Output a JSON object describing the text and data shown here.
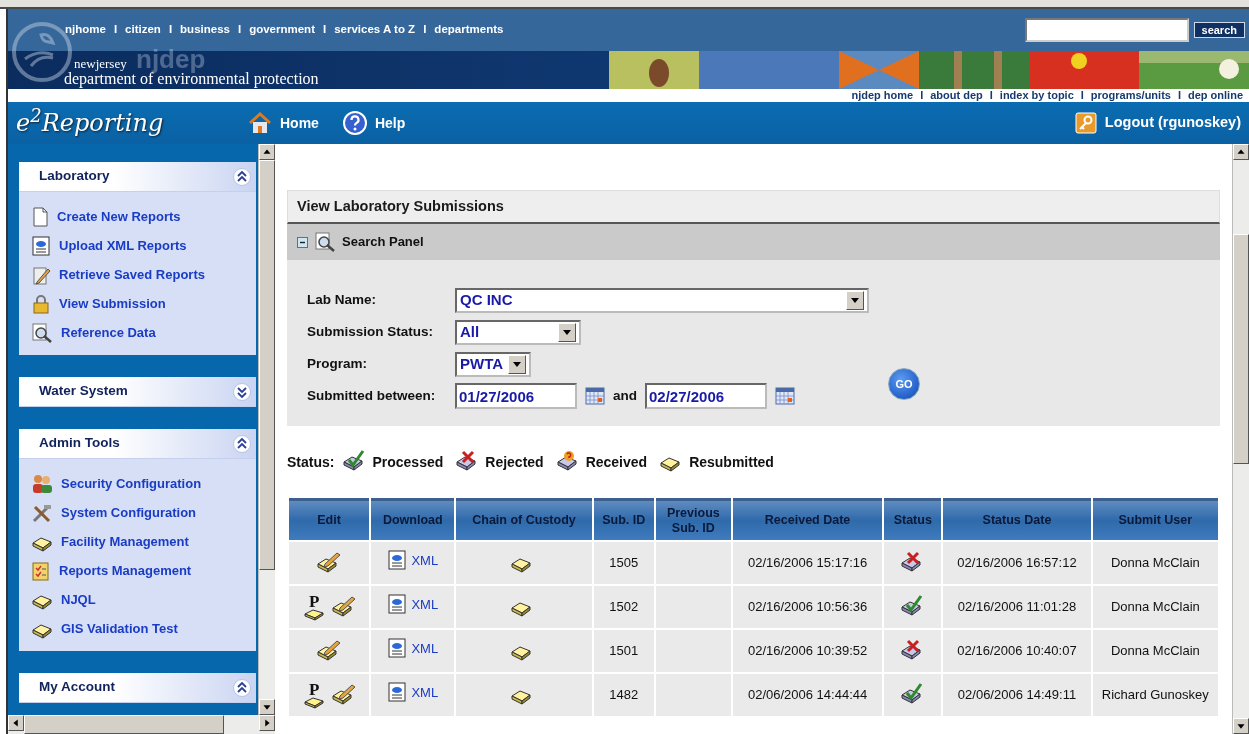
{
  "top_nav": {
    "items": [
      {
        "kind": "link",
        "label": "njhome"
      },
      {
        "kind": "separator",
        "label": "I"
      },
      {
        "kind": "link",
        "label": "citizen"
      },
      {
        "kind": "separator",
        "label": "I"
      },
      {
        "kind": "link",
        "label": "business"
      },
      {
        "kind": "separator",
        "label": "I"
      },
      {
        "kind": "link",
        "label": "government"
      },
      {
        "kind": "separator",
        "label": "I"
      },
      {
        "kind": "link",
        "label": "services A to Z"
      },
      {
        "kind": "separator",
        "label": "I"
      },
      {
        "kind": "link",
        "label": "departments"
      }
    ],
    "search_button": "search"
  },
  "banner": {
    "state": "newjersey",
    "watermark": "njdep",
    "department": "department of environmental protection"
  },
  "sub_nav": [
    {
      "kind": "link",
      "label": "njdep home"
    },
    {
      "kind": "separator",
      "label": "I"
    },
    {
      "kind": "link",
      "label": "about dep"
    },
    {
      "kind": "separator",
      "label": "I"
    },
    {
      "kind": "link",
      "label": "index by topic"
    },
    {
      "kind": "separator",
      "label": "I"
    },
    {
      "kind": "link",
      "label": "programs/units"
    },
    {
      "kind": "separator",
      "label": "I"
    },
    {
      "kind": "link",
      "label": "dep online"
    }
  ],
  "app_bar": {
    "logo": "e$^{2}$Reporting",
    "links": [
      {
        "kind": "home",
        "label": "Home"
      },
      {
        "kind": "help",
        "label": "Help"
      }
    ],
    "logout": "Logout (rgunoskey)"
  },
  "sidebar": {
    "panels": [
      {
        "title": "Laboratory",
        "expanded": true,
        "items": [
          {
            "kind": "document",
            "label": "Create New Reports"
          },
          {
            "kind": "xml",
            "label": "Upload XML Reports"
          },
          {
            "kind": "pencil",
            "label": "Retrieve Saved Reports"
          },
          {
            "kind": "lock",
            "label": "View Submission"
          },
          {
            "kind": "magnifier",
            "label": "Reference Data"
          }
        ]
      },
      {
        "title": "Water System",
        "expanded": false
      },
      {
        "title": "Admin Tools",
        "expanded": true,
        "items": [
          {
            "kind": "people",
            "label": "Security Configuration"
          },
          {
            "kind": "tools",
            "label": "System Configuration"
          },
          {
            "kind": "tray",
            "label": "Facility Management"
          },
          {
            "kind": "checklist",
            "label": "Reports Management"
          },
          {
            "kind": "tray",
            "label": "NJQL"
          },
          {
            "kind": "tray",
            "label": "GIS Validation Test"
          }
        ]
      },
      {
        "title": "My Account",
        "expanded": true
      }
    ]
  },
  "page_title": "View Laboratory Submissions",
  "search_panel": {
    "title": "Search Panel",
    "expanded": true,
    "fields": [
      {
        "kind": "select",
        "label": "Lab Name:",
        "value": "QC INC"
      },
      {
        "kind": "select",
        "label": "Submission Status:",
        "value": "All"
      },
      {
        "kind": "select",
        "label": "Program:",
        "value": "PWTA"
      },
      {
        "kind": "daterange",
        "label": "Submitted between:",
        "from": "01/27/2006",
        "joiner": "and",
        "to": "02/27/2006"
      }
    ],
    "go_button": "GO"
  },
  "status_legend": {
    "label": "Status:",
    "items": [
      {
        "kind": "processed",
        "label": "Processed"
      },
      {
        "kind": "rejected",
        "label": "Rejected"
      },
      {
        "kind": "received",
        "label": "Received"
      },
      {
        "kind": "resubmitted",
        "label": "Resubmitted"
      }
    ]
  },
  "table": {
    "columns": [
      "Edit",
      "Download",
      "Chain of Custody",
      "Sub. ID",
      "Previous Sub. ID",
      "Received Date",
      "Status",
      "Status Date",
      "Submit User"
    ],
    "rows": [
      {
        "download": "XML",
        "sub_id": "1505",
        "received_date": "02/16/2006 15:17:16",
        "status": {
          "kind": "rejected"
        },
        "status_date": "02/16/2006 16:57:12",
        "submit_user": "Donna McClain"
      },
      {
        "print_icon": "P",
        "download": "XML",
        "sub_id": "1502",
        "received_date": "02/16/2006 10:56:36",
        "status": {
          "kind": "processed"
        },
        "status_date": "02/16/2006 11:01:28",
        "submit_user": "Donna McClain"
      },
      {
        "download": "XML",
        "sub_id": "1501",
        "received_date": "02/16/2006 10:39:52",
        "status": {
          "kind": "rejected"
        },
        "status_date": "02/16/2006 10:40:07",
        "submit_user": "Donna McClain"
      },
      {
        "print_icon": "P",
        "download": "XML",
        "sub_id": "1482",
        "received_date": "02/06/2006 14:44:44",
        "status": {
          "kind": "processed"
        },
        "status_date": "02/06/2006 14:49:11",
        "submit_user": "Richard Gunoskey"
      }
    ]
  }
}
